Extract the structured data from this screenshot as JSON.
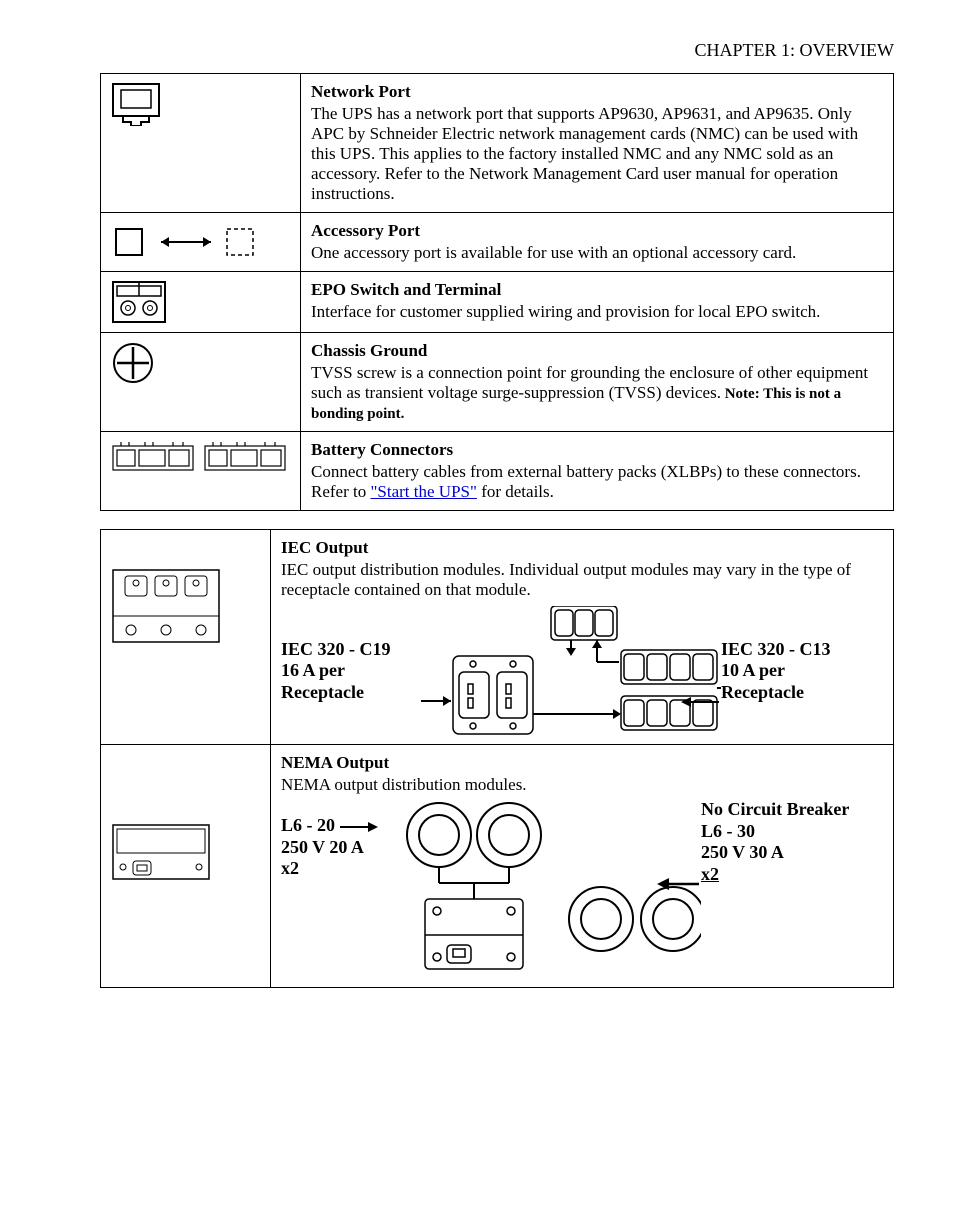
{
  "page_header": "CHAPTER 1: OVERVIEW",
  "rows": [
    {
      "title": "Network Port",
      "body": "The UPS has a network port that supports AP9630, AP9631, and AP9635. Only APC by Schneider Electric network management cards (NMC) can be used with this UPS. This applies to the factory installed NMC and any NMC sold as an accessory. Refer to the Network Management Card user manual for operation instructions."
    },
    {
      "title": "Accessory Port",
      "body": "One accessory port is available for use with an optional accessory card."
    },
    {
      "title": "EPO Switch and Terminal",
      "body": "Interface for customer supplied wiring and provision for local EPO switch."
    },
    {
      "title": "Chassis Ground",
      "body_prefix": "TVSS screw is a connection point for grounding the enclosure of other equipment such as transient voltage surge-suppression (TVSS) devices.",
      "note": " Note: This is not a bonding point."
    },
    {
      "title": "Battery Connectors",
      "body_prefix": "Connect battery cables from external battery packs (XLBPs) to these connectors. Refer to ",
      "link": "\"Start the UPS\"",
      "body_suffix": " for details."
    }
  ],
  "outputs_title": "IEC Output",
  "outputs_body": "IEC output distribution modules. Individual output modules may vary in the type of receptacle contained on that module.",
  "outputs_c19": {
    "name": "IEC 320 - C19",
    "spec": "16 A per",
    "unit": "Receptacle"
  },
  "outputs_c13": {
    "name": "IEC 320 - C13",
    "spec": "10 A per",
    "unit": "Receptacle"
  },
  "nema_title": "NEMA Output",
  "nema_body": "NEMA output distribution modules.",
  "nema_l620": {
    "name": "L6 - 20",
    "spec": "250 V 20 A",
    "qty": "x2"
  },
  "nema_l630": {
    "note": "No Circuit Breaker",
    "name": "L6 - 30",
    "spec": "250 V 30 A",
    "qty": "x2"
  }
}
